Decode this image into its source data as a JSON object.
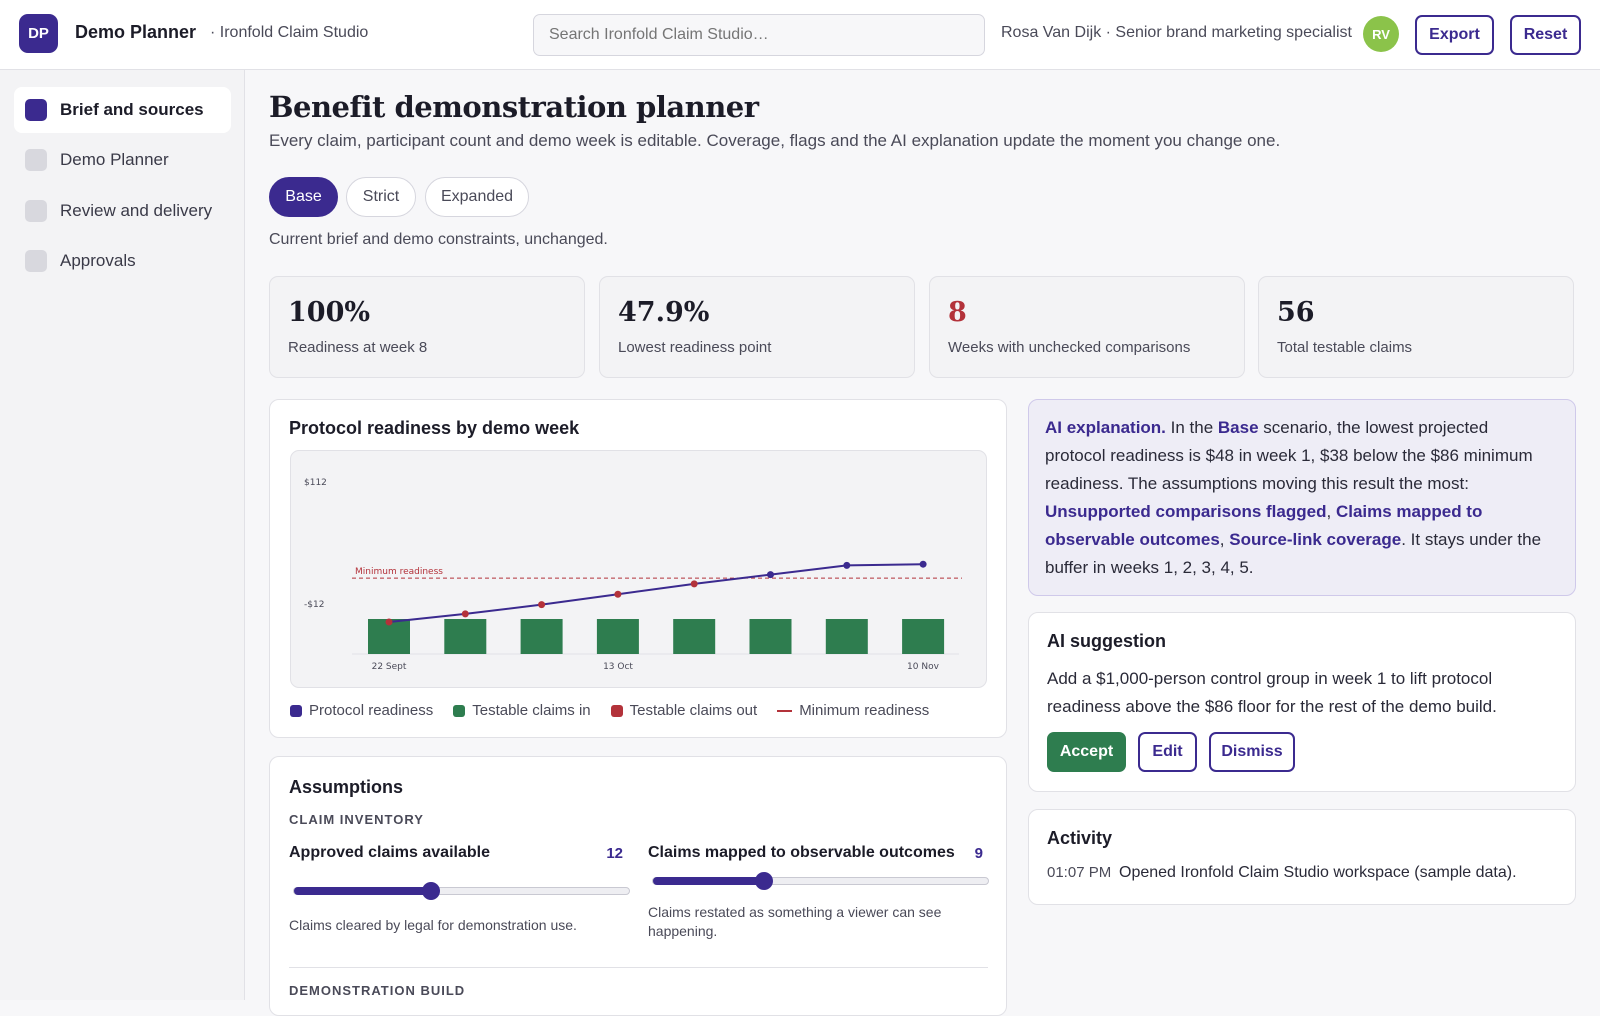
{
  "header": {
    "logo_text": "DP",
    "app_name": "Demo Planner",
    "workspace": "· Ironfold Claim Studio",
    "search_placeholder": "Search Ironfold Claim Studio…",
    "user": "Rosa Van Dijk · Senior brand marketing specialist",
    "avatar": "RV",
    "export_label": "Export",
    "reset_label": "Reset"
  },
  "sidebar": {
    "items": [
      {
        "label": "Brief and sources",
        "active": true
      },
      {
        "label": "Demo Planner",
        "active": false
      },
      {
        "label": "Review and delivery",
        "active": false
      },
      {
        "label": "Approvals",
        "active": false
      }
    ]
  },
  "page": {
    "title": "Benefit demonstration planner",
    "subtitle": "Every claim, participant count and demo week is editable. Coverage, flags and the AI explanation update the moment you change one.",
    "scenarios": [
      "Base",
      "Strict",
      "Expanded"
    ],
    "active_scenario": "Base",
    "scenario_description": "Current brief and demo constraints, unchanged."
  },
  "kpis": [
    {
      "value": "100%",
      "label": "Readiness at week 8"
    },
    {
      "value": "47.9%",
      "label": "Lowest readiness point"
    },
    {
      "value": "8",
      "label": "Weeks with unchecked comparisons",
      "alert": true
    },
    {
      "value": "56",
      "label": "Total testable claims"
    }
  ],
  "chart": {
    "title": "Protocol readiness by demo week",
    "legend": [
      "Protocol readiness",
      "Testable claims in",
      "Testable claims out",
      "Minimum readiness"
    ]
  },
  "chart_data": {
    "type": "line",
    "x_ticks": [
      "22 Sept",
      "13 Oct",
      "10 Nov"
    ],
    "y_ticks": [
      "$112",
      "-$12"
    ],
    "reference_label": "Minimum readiness",
    "series": [
      {
        "name": "Protocol readiness",
        "values": [
          48,
          55,
          63,
          72,
          81,
          89,
          97,
          98
        ]
      },
      {
        "name": "Testable claims in",
        "values": [
          7,
          7,
          7,
          7,
          7,
          7,
          7,
          7
        ]
      },
      {
        "name": "Testable claims out",
        "values": [
          0,
          0,
          0,
          0,
          0,
          0,
          0,
          0
        ]
      },
      {
        "name": "Minimum readiness",
        "values": [
          86,
          86,
          86,
          86,
          86,
          86,
          86,
          86
        ]
      }
    ],
    "point_colors": [
      "#b3323a",
      "#b3323a",
      "#b3323a",
      "#b3323a",
      "#b3323a",
      "#3b2a8f",
      "#3b2a8f",
      "#3b2a8f"
    ],
    "colors": {
      "line": "#3b2a8f",
      "bars": "#2e7d4f",
      "threshold": "#b3323a",
      "alert": "#b3323a"
    }
  },
  "ai_explanation": {
    "lead": "AI explanation.",
    "t1": " In the ",
    "scenario": "Base",
    "t2": " scenario, the lowest projected protocol readiness is $48 in week 1, $38 below the $86 minimum readiness. The assumptions moving this result the most: ",
    "f1": "Unsupported comparisons flagged",
    "sep1": ", ",
    "f2": "Claims mapped to observable outcomes",
    "sep2": ", ",
    "f3": "Source-link coverage",
    "t3": ". It stays under the buffer in weeks 1, 2, 3, 4, 5."
  },
  "ai_suggestion": {
    "title": "AI suggestion",
    "text": "Add a $1,000-person control group in week 1 to lift protocol readiness above the $86 floor for the rest of the demo build.",
    "accept": "Accept",
    "edit": "Edit",
    "dismiss": "Dismiss"
  },
  "activity": {
    "title": "Activity",
    "entries": [
      {
        "time": "01:07 PM",
        "text": "Opened Ironfold Claim Studio workspace (sample data)."
      }
    ]
  },
  "assumptions": {
    "title": "Assumptions",
    "section1": "CLAIM INVENTORY",
    "sliders": [
      {
        "label": "Approved claims available",
        "value": "12",
        "level": 0.41,
        "help": "Claims cleared by legal for demonstration use."
      },
      {
        "label": "Claims mapped to observable outcomes",
        "value": "9",
        "level": 0.33,
        "help": "Claims restated as something a viewer can see happening."
      }
    ],
    "section2": "DEMONSTRATION BUILD"
  }
}
